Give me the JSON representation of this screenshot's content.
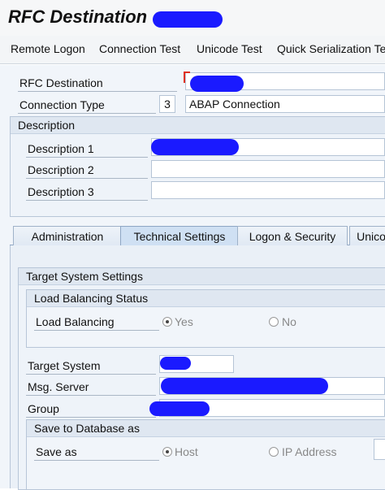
{
  "title": {
    "text": "RFC Destination"
  },
  "toolbar": {
    "remote_logon": "Remote Logon",
    "connection_test": "Connection Test",
    "unicode_test": "Unicode Test",
    "quick_serialization": "Quick Serialization Te"
  },
  "header_fields": {
    "rfc_destination_label": "RFC Destination",
    "connection_type_label": "Connection Type",
    "connection_type_code": "3",
    "connection_type_value": "ABAP Connection"
  },
  "description": {
    "heading": "Description",
    "desc1_label": "Description 1",
    "desc2_label": "Description 2",
    "desc3_label": "Description 3"
  },
  "tabs": [
    {
      "label": "Administration"
    },
    {
      "label": "Technical Settings"
    },
    {
      "label": "Logon & Security"
    },
    {
      "label": "Unico"
    }
  ],
  "technical": {
    "target_system_settings": "Target System Settings",
    "load_balancing_status": "Load Balancing Status",
    "load_balancing_label": "Load Balancing",
    "yes": "Yes",
    "no": "No",
    "target_system_label": "Target System",
    "msg_server_label": "Msg. Server",
    "group_label": "Group",
    "save_to_db": "Save to Database as",
    "save_as_label": "Save as",
    "host": "Host",
    "ip_address": "IP Address"
  },
  "colors": {
    "redaction": "#1a1aff",
    "tab_active": "#cfe0f3"
  }
}
